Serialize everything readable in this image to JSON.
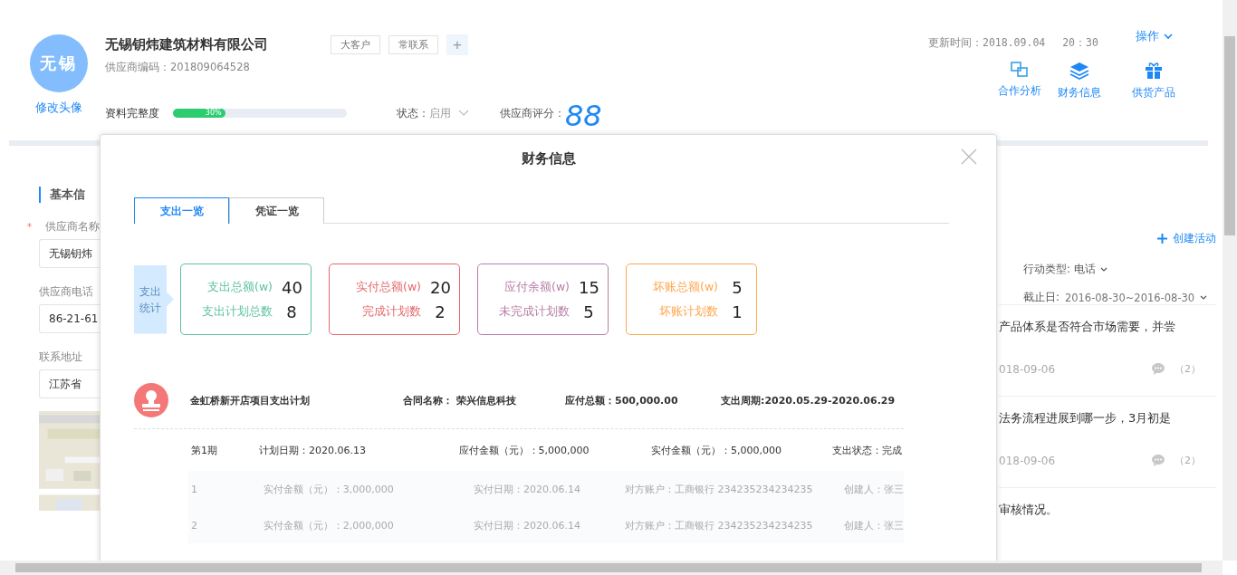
{
  "header": {
    "avatar_text": "无锡",
    "avatar_link": "修改头像",
    "company": "无锡钥炜建筑材料有限公司",
    "tags": [
      "大客户",
      "常联系"
    ],
    "add_tag": "+",
    "code": "供应商编码：201809064528",
    "updated": "更新时间：2018.09.04　 20：30",
    "action_menu": "操作",
    "completeness": {
      "label": "资料完整度",
      "level": 0.3,
      "reading": "30%"
    },
    "status": {
      "label": "状态：",
      "value": "启用"
    },
    "score": {
      "label": "供应商评分：",
      "value": "88"
    },
    "shortcuts": [
      {
        "kind": "cooperation",
        "label": "合作分析"
      },
      {
        "kind": "layers",
        "label": "财务信息"
      },
      {
        "kind": "gift",
        "label": "供货产品"
      }
    ]
  },
  "basic": {
    "section_title": "基本信",
    "fields": [
      {
        "required_mark": "*",
        "label": "供应商名称",
        "value": "无锡钥炜"
      },
      {
        "label": "供应商电话",
        "value": "86-21-61"
      },
      {
        "label": "联系地址",
        "value": "江苏省"
      }
    ]
  },
  "activity": {
    "create": "创建活动",
    "filter_type": {
      "label": "行动类型:",
      "value": "电话"
    },
    "deadline": {
      "label": "截止日:",
      "value": "2016-08-30~2016-08-30"
    },
    "items": [
      {
        "text": "产品体系是否符合市场需要，并尝",
        "date": "018-09-06",
        "comments": "（2）"
      },
      {
        "text": "法务流程进展到哪一步，3月初是",
        "date": "018-09-06",
        "comments": "（2）"
      },
      {
        "text": "审核情况。"
      }
    ]
  },
  "dialog": {
    "title": "财务信息",
    "tabs": [
      {
        "label": "支出一览",
        "selected": true
      },
      {
        "label": "凭证一览",
        "selected": false
      }
    ],
    "stats_label": "支出统计",
    "stats": [
      {
        "color": "#5cc29f",
        "rows": [
          {
            "label": "支出总额(w)",
            "value": "40"
          },
          {
            "label": "支出计划总数",
            "value": "8"
          }
        ]
      },
      {
        "color": "#e5676a",
        "rows": [
          {
            "label": "实付总额(w)",
            "value": "20"
          },
          {
            "label": "完成计划数",
            "value": "2"
          }
        ]
      },
      {
        "color": "#b77fa6",
        "rows": [
          {
            "label": "应付余额(w)",
            "value": "15"
          },
          {
            "label": "未完成计划数",
            "value": "5"
          }
        ]
      },
      {
        "color": "#ffa64d",
        "rows": [
          {
            "label": "坏账总额(w)",
            "value": "5"
          },
          {
            "label": "坏账计划数",
            "value": "1"
          }
        ]
      }
    ],
    "plan": {
      "title": "金虹桥新开店项目支出计划",
      "contract_label": "合同名称：",
      "contract": "荣兴信息科技",
      "total": "应付总额：500,000.00",
      "period": "支出周期:2020.05.29-2020.06.29",
      "stage": {
        "name": "第1期",
        "plan_date": "计划日期：2020.06.13",
        "payable": "应付金额（元）：5,000,000",
        "paid": "实付金额（元）：5,000,000",
        "status": "支出状态：完成"
      },
      "payments": [
        {
          "index": "1",
          "amount": "实付金额（元）：3,000,000",
          "date": "实付日期：2020.06.14",
          "account": "对方账户：工商银行 234235234234235",
          "creator": "创建人：张三"
        },
        {
          "index": "2",
          "amount": "实付金额（元）：2,000,000",
          "date": "实付日期：2020.06.14",
          "account": "对方账户：工商银行 234235234234235",
          "creator": "创建人：张三"
        }
      ]
    }
  }
}
